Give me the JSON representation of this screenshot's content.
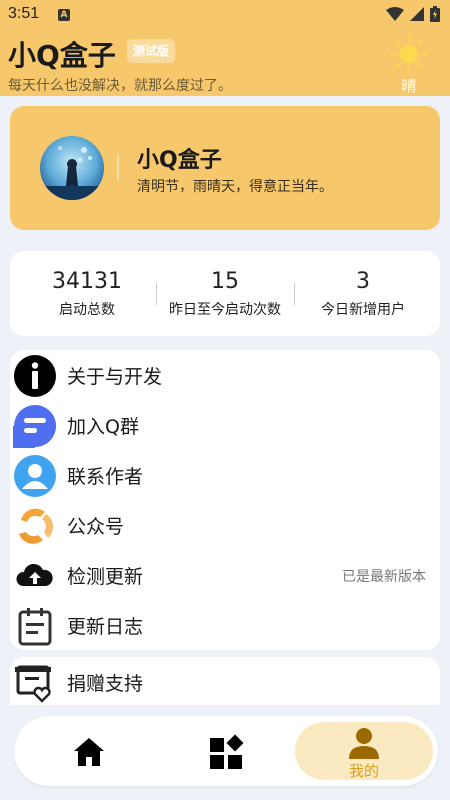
{
  "status_bar": {
    "time": "3:51",
    "indicator": "A",
    "icons": [
      "wifi-icon",
      "signal-icon",
      "battery-icon"
    ]
  },
  "header": {
    "title": "小Q盒子",
    "badge": "测试版",
    "subtitle": "每天什么也没解决，就那么度过了。",
    "weather_icon": "sun-icon",
    "weather_label": "晴"
  },
  "profile": {
    "name": "小Q盒子",
    "motto": "清明节，雨晴天，得意正当年。"
  },
  "stats": [
    {
      "value": "34131",
      "label": "启动总数"
    },
    {
      "value": "15",
      "label": "昨日至今启动次数"
    },
    {
      "value": "3",
      "label": "今日新增用户"
    }
  ],
  "menu": [
    {
      "icon": "info-icon",
      "label": "关于与开发",
      "right": ""
    },
    {
      "icon": "chat-group-icon",
      "label": "加入Q群",
      "right": ""
    },
    {
      "icon": "person-icon",
      "label": "联系作者",
      "right": ""
    },
    {
      "icon": "official-account-icon",
      "label": "公众号",
      "right": ""
    },
    {
      "icon": "cloud-upload-icon",
      "label": "检测更新",
      "right": "已是最新版本"
    },
    {
      "icon": "clipboard-icon",
      "label": "更新日志",
      "right": ""
    }
  ],
  "menu2": [
    {
      "icon": "donate-icon",
      "label": "捐赠支持"
    }
  ],
  "bottom_nav": {
    "items": [
      {
        "icon": "home-icon",
        "label": ""
      },
      {
        "icon": "apps-icon",
        "label": ""
      },
      {
        "icon": "user-icon",
        "label": "我的",
        "active": true
      }
    ]
  },
  "colors": {
    "accent": "#f7c86b",
    "background": "#eef1f8",
    "active_nav": "#fbeac1",
    "active_text": "#d9a227"
  }
}
